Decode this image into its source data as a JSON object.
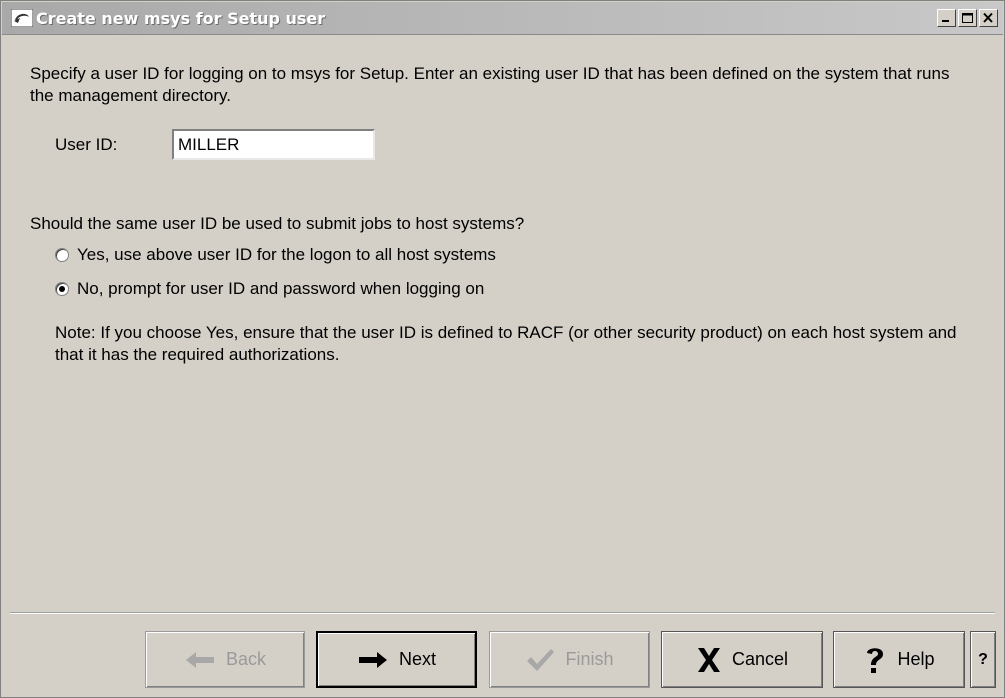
{
  "window": {
    "title": "Create new msys for Setup user"
  },
  "main": {
    "intro_text": "Specify a user ID for logging on to msys for Setup. Enter an existing user ID that has been defined on the system that runs the management directory.",
    "userid_label": "User ID:",
    "userid_value": "MILLER",
    "question": "Should the same user ID be used to submit jobs to host systems?",
    "options": [
      {
        "label": "Yes, use above user ID for the logon to all host systems",
        "selected": false
      },
      {
        "label": "No, prompt for user ID and password when logging on",
        "selected": true
      }
    ],
    "note": "Note: If you choose Yes, ensure that the user ID is defined to RACF (or other security product) on each host system and that it has the required authorizations."
  },
  "buttons": {
    "back": "Back",
    "next": "Next",
    "finish": "Finish",
    "cancel": "Cancel",
    "help": "Help",
    "context_help": "?"
  }
}
